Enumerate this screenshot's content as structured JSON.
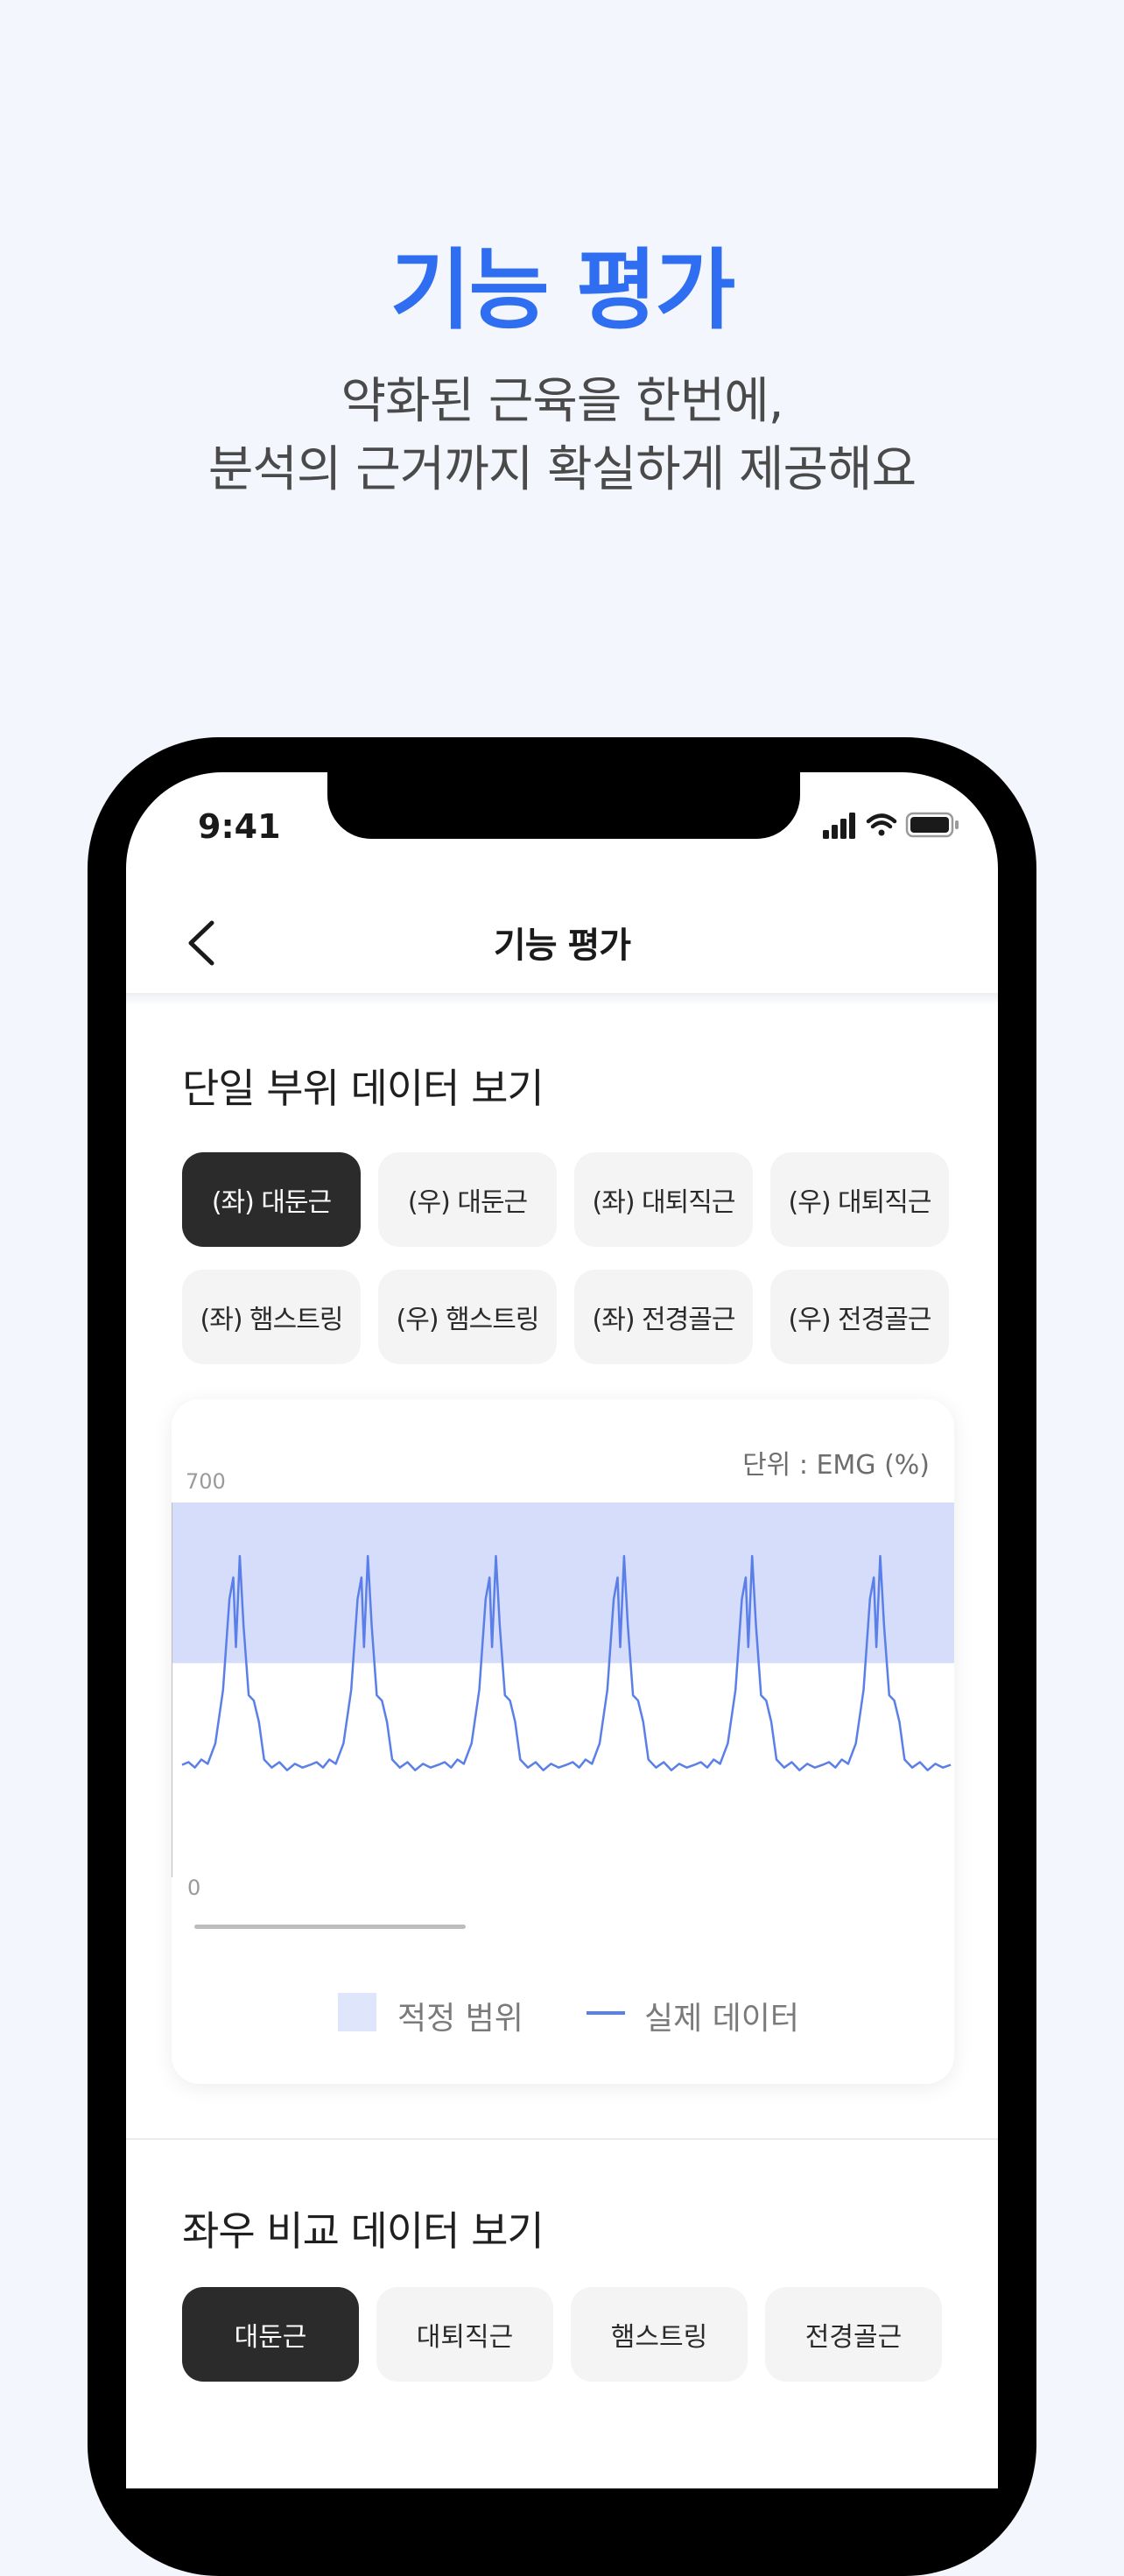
{
  "hero": {
    "title": "기능 평가",
    "subtitle_line1": "약화된 근육을 한번에,",
    "subtitle_line2": "분석의 근거까지 확실하게 제공해요"
  },
  "status_bar": {
    "time": "9:41",
    "icons": [
      "signal-icon",
      "wifi-icon",
      "battery-icon"
    ]
  },
  "nav": {
    "title": "기능 평가",
    "back_icon": "chevron-left-icon"
  },
  "single_section": {
    "title": "단일 부위 데이터 보기",
    "chips": [
      {
        "label": "(좌) 대둔근",
        "active": true
      },
      {
        "label": "(우) 대둔근",
        "active": false
      },
      {
        "label": "(좌) 대퇴직근",
        "active": false
      },
      {
        "label": "(우) 대퇴직근",
        "active": false
      },
      {
        "label": "(좌) 햄스트링",
        "active": false
      },
      {
        "label": "(우) 햄스트링",
        "active": false
      },
      {
        "label": "(좌) 전경골근",
        "active": false
      },
      {
        "label": "(우) 전경골근",
        "active": false
      }
    ]
  },
  "chart": {
    "unit_label": "단위 : EMG (%)",
    "y_max_label": "700",
    "y_min_label": "0",
    "legend_range": "적정 범위",
    "legend_actual": "실제 데이터",
    "colors": {
      "range_band": "#d5ddfb",
      "line": "#5b7fe8",
      "legend_swatch": "#dfe6fb"
    }
  },
  "chart_data": {
    "type": "line",
    "ylim": [
      0,
      700
    ],
    "yticks": [
      "0",
      "700"
    ],
    "ylabel": "단위 : EMG (%)",
    "optimal_range": [
      400,
      700
    ],
    "legend_placement": "bottom-center",
    "cycles": 6,
    "cycle_profile": [
      [
        0,
        210
      ],
      [
        0.05,
        215
      ],
      [
        0.1,
        205
      ],
      [
        0.15,
        220
      ],
      [
        0.2,
        212
      ],
      [
        0.26,
        250
      ],
      [
        0.32,
        350
      ],
      [
        0.37,
        520
      ],
      [
        0.4,
        560
      ],
      [
        0.42,
        430
      ],
      [
        0.45,
        600
      ],
      [
        0.48,
        470
      ],
      [
        0.52,
        340
      ],
      [
        0.56,
        330
      ],
      [
        0.6,
        290
      ],
      [
        0.64,
        220
      ],
      [
        0.7,
        205
      ],
      [
        0.76,
        215
      ],
      [
        0.82,
        200
      ],
      [
        0.88,
        212
      ],
      [
        0.94,
        205
      ],
      [
        1.0,
        210
      ]
    ],
    "series": [
      {
        "name": "실제 데이터"
      }
    ]
  },
  "compare_section": {
    "title": "좌우 비교 데이터 보기",
    "chips": [
      {
        "label": "대둔근",
        "active": true
      },
      {
        "label": "대퇴직근",
        "active": false
      },
      {
        "label": "햄스트링",
        "active": false
      },
      {
        "label": "전경골근",
        "active": false
      }
    ]
  }
}
